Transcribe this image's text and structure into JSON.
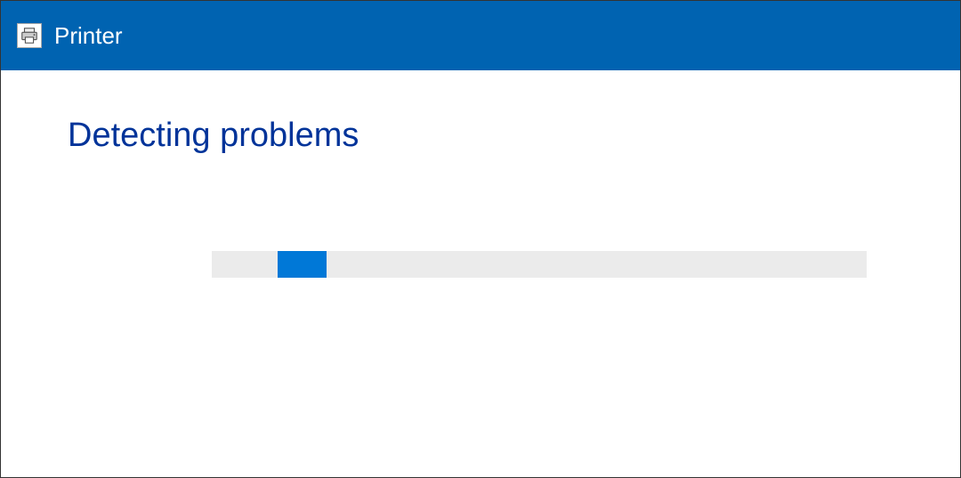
{
  "titlebar": {
    "title": "Printer"
  },
  "content": {
    "heading": "Detecting problems"
  },
  "progress": {
    "chunk_left_percent": 10,
    "chunk_width_percent": 7.5
  },
  "colors": {
    "titlebar_bg": "#0063b1",
    "heading_text": "#003399",
    "progress_track": "#ebebeb",
    "progress_chunk": "#0078d7"
  }
}
